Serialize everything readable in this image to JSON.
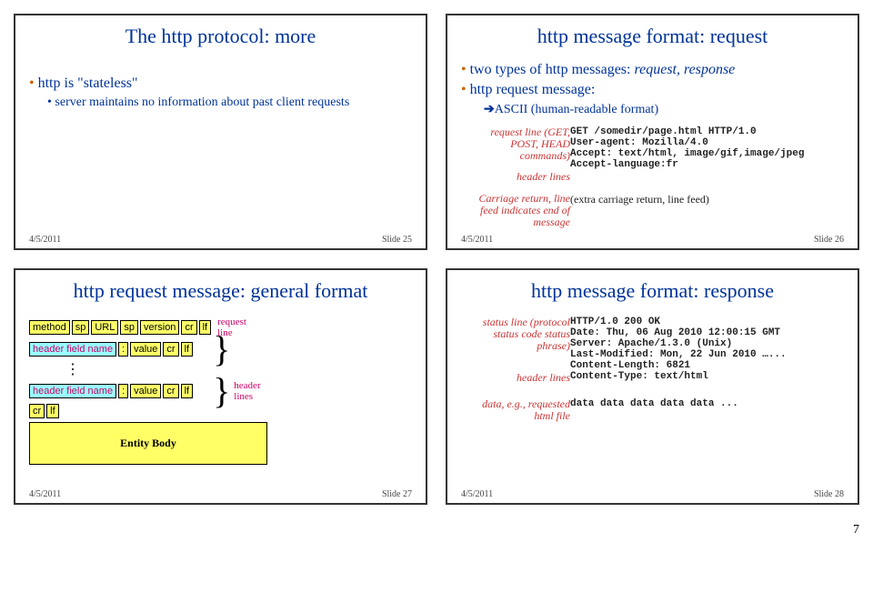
{
  "slide25": {
    "title": "The http protocol: more",
    "b1": "http is \"stateless\"",
    "sb1": "server maintains no information about past client requests",
    "date": "4/5/2011",
    "num": "Slide 25"
  },
  "slide26": {
    "title": "http message format: request",
    "b1": "two types of http messages: ",
    "b1i": "request, response",
    "b2": "http request message:",
    "ab1": "ASCII (human-readable format)",
    "lbl1": "request line (GET, POST, HEAD commands)",
    "lbl2": "header lines",
    "lbl3": "Carriage return, line feed indicates end of message",
    "m1": "GET /somedir/page.html HTTP/1.0",
    "m2": "User-agent: Mozilla/4.0",
    "m3": "Accept: text/html, image/gif,image/jpeg",
    "m4": "Accept-language:fr",
    "m5": "(extra carriage return, line feed)",
    "date": "4/5/2011",
    "num": "Slide 26"
  },
  "slide27": {
    "title": "http request message: general format",
    "method": "method",
    "sp": "sp",
    "url": "URL",
    "version": "version",
    "cr": "cr",
    "lf": "lf",
    "hfn": "header field name",
    "colon": ":",
    "value": "value",
    "entity": "Entity Body",
    "rline": "request line",
    "hlines": "header lines",
    "date": "4/5/2011",
    "num": "Slide 27"
  },
  "slide28": {
    "title": "http message format: response",
    "lbl1": "status line (protocol status code status phrase)",
    "lbl2": "header lines",
    "lbl3": "data, e.g., requested html file",
    "m1": "HTTP/1.0 200 OK",
    "m2": "Date: Thu, 06 Aug 2010 12:00:15 GMT",
    "m3": "Server: Apache/1.3.0 (Unix)",
    "m4": "Last-Modified: Mon, 22 Jun 2010 …...",
    "m5": "Content-Length: 6821",
    "m6": "Content-Type: text/html",
    "m7": "data data data data data ...",
    "date": "4/5/2011",
    "num": "Slide 28"
  },
  "pagenum": "7"
}
